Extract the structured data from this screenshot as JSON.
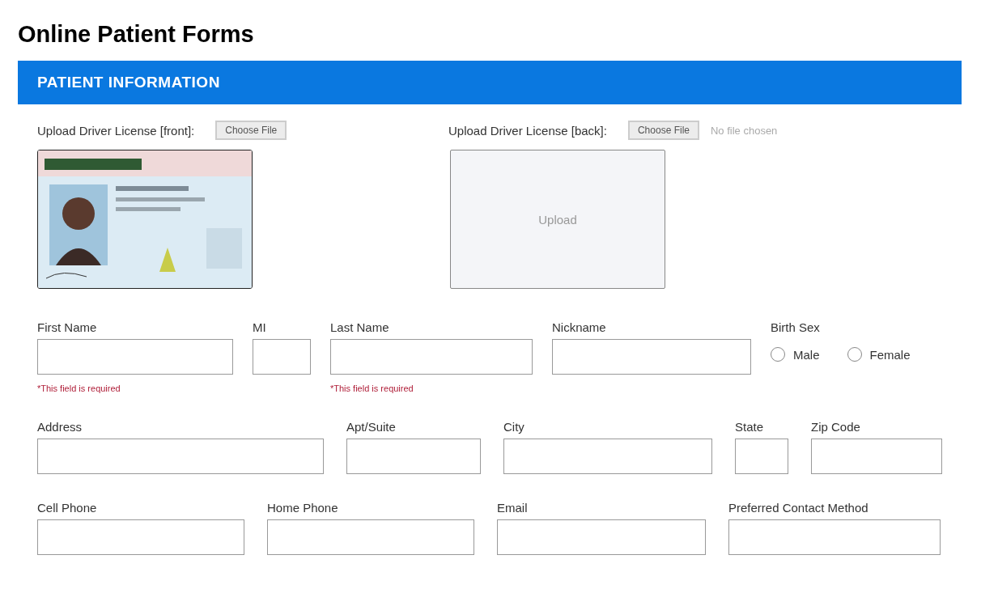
{
  "page_title": "Online Patient Forms",
  "section": {
    "title": "PATIENT INFORMATION"
  },
  "uploads": [
    {
      "label": "Upload Driver License [front]:",
      "button": "Choose File"
    },
    {
      "label": "Upload Driver License [back]:",
      "button": "Choose File",
      "status": "No file chosen",
      "preview": {
        "kind": "dropzone",
        "text": "Upload"
      }
    }
  ],
  "rows": [
    {
      "fields": [
        {
          "kind": "text",
          "label": "First Name",
          "error": "*This field is required"
        },
        {
          "kind": "text",
          "label": "MI"
        },
        {
          "kind": "text",
          "label": "Last Name",
          "error": "*This field is required"
        },
        {
          "kind": "text",
          "label": "Nickname"
        },
        {
          "kind": "radio",
          "label": "Birth Sex",
          "options": [
            {
              "label": "Male",
              "selected": false
            },
            {
              "label": "Female",
              "selected": false
            }
          ]
        }
      ]
    },
    {
      "fields": [
        {
          "kind": "text",
          "label": "Address"
        },
        {
          "kind": "text",
          "label": "Apt/Suite"
        },
        {
          "kind": "text",
          "label": "City"
        },
        {
          "kind": "text",
          "label": "State"
        },
        {
          "kind": "text",
          "label": "Zip Code"
        }
      ]
    },
    {
      "fields": [
        {
          "kind": "text",
          "label": "Cell Phone"
        },
        {
          "kind": "text",
          "label": "Home Phone"
        },
        {
          "kind": "text",
          "label": "Email"
        },
        {
          "kind": "text",
          "label": "Preferred Contact Method"
        }
      ]
    }
  ]
}
